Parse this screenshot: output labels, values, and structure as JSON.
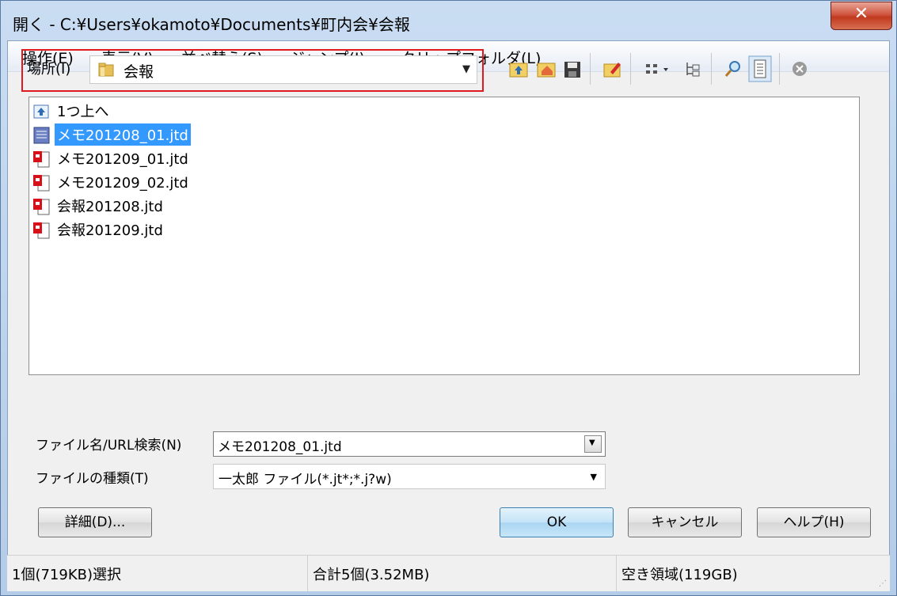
{
  "window": {
    "title": "開く - C:¥Users¥okamoto¥Documents¥町内会¥会報"
  },
  "menu": [
    {
      "label": "操作(E)"
    },
    {
      "label": "表示(V)"
    },
    {
      "label": "並べ替え(S)"
    },
    {
      "label": "ジャンプ(J)"
    },
    {
      "label": "クリップフォルダ(L)"
    }
  ],
  "location": {
    "label": "場所(I)",
    "value": "会報"
  },
  "toolbar": {
    "icons": [
      "up-folder-icon",
      "home-folder-icon",
      "save-icon",
      "clip-folder-icon",
      "view-mode-icon",
      "tree-view-icon",
      "search-icon",
      "preview-icon",
      "stop-icon"
    ]
  },
  "files": [
    {
      "name": "1つ上へ",
      "icon": "up-folder-icon",
      "selected": false
    },
    {
      "name": "メモ201208_01.jtd",
      "icon": "jtd-doc-icon",
      "selected": true
    },
    {
      "name": "メモ201209_01.jtd",
      "icon": "ichitaro-doc-icon",
      "selected": false
    },
    {
      "name": "メモ201209_02.jtd",
      "icon": "ichitaro-doc-icon",
      "selected": false
    },
    {
      "name": "会報201208.jtd",
      "icon": "ichitaro-doc-icon",
      "selected": false
    },
    {
      "name": "会報201209.jtd",
      "icon": "ichitaro-doc-icon",
      "selected": false
    }
  ],
  "fields": {
    "filename_label": "ファイル名/URL検索(N)",
    "filename_value": "メモ201208_01.jtd",
    "filetype_label": "ファイルの種類(T)",
    "filetype_value": "一太郎 ファイル(*.jt*;*.j?w)"
  },
  "buttons": {
    "details": "詳細(D)...",
    "ok": "OK",
    "cancel": "キャンセル",
    "help": "ヘルプ(H)"
  },
  "status": {
    "selection": "1個(719KB)選択",
    "total": "合計5個(3.52MB)",
    "free": "空き領域(119GB)"
  },
  "colors": {
    "selection": "#3399ff",
    "highlight_border": "#e0191e",
    "close_button": "#c0391f"
  }
}
